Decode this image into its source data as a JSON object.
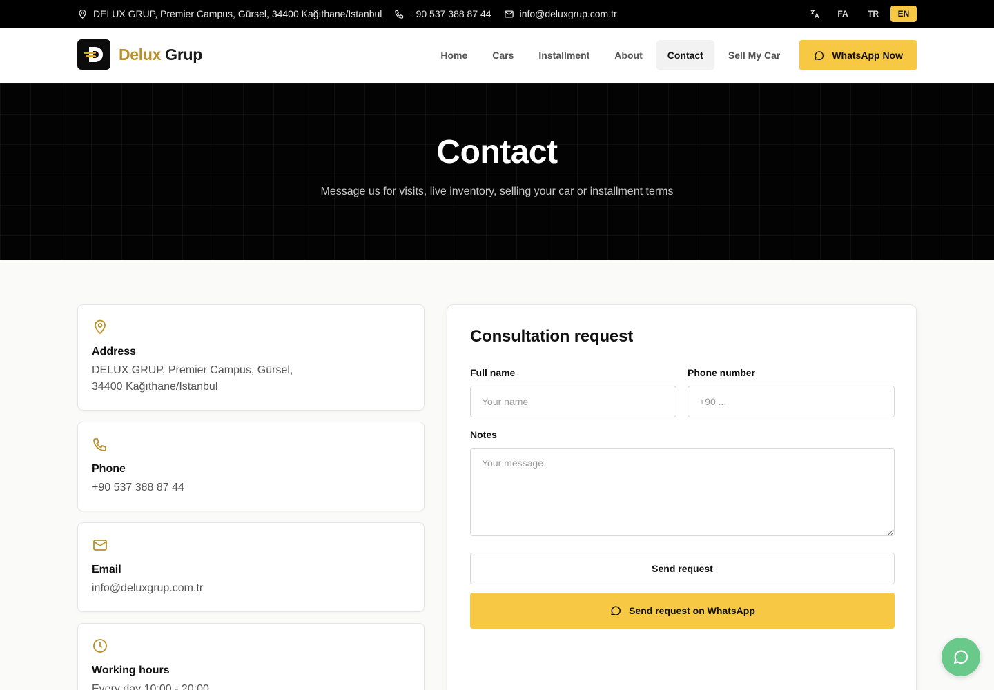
{
  "topbar": {
    "address": "DELUX GRUP, Premier Campus, Gürsel, 34400 Kağıthane/Istanbul",
    "phone": "+90 537 388 87 44",
    "email": "info@deluxgrup.com.tr",
    "languages": [
      "FA",
      "TR",
      "EN"
    ],
    "active_language": "EN"
  },
  "header": {
    "logo_part1": "Delux",
    "logo_part2": "Grup",
    "nav": [
      "Home",
      "Cars",
      "Installment",
      "About",
      "Contact",
      "Sell My Car"
    ],
    "active_nav": "Contact",
    "cta_label": "WhatsApp Now"
  },
  "hero": {
    "title": "Contact",
    "subtitle": "Message us for visits, live inventory, selling your car or installment terms"
  },
  "cards": {
    "address_title": "Address",
    "address_value": "DELUX GRUP, Premier Campus, Gürsel, 34400 Kağıthane/Istanbul",
    "phone_title": "Phone",
    "phone_value": "+90 537 388 87 44",
    "email_title": "Email",
    "email_value": "info@deluxgrup.com.tr",
    "hours_title": "Working hours",
    "hours_value": "Every day 10:00 - 20:00"
  },
  "form": {
    "title": "Consultation request",
    "name_label": "Full name",
    "name_placeholder": "Your name",
    "phone_label": "Phone number",
    "phone_placeholder": "+90 ...",
    "notes_label": "Notes",
    "notes_placeholder": "Your message",
    "send_label": "Send request",
    "send_whatsapp_label": "Send request on WhatsApp"
  },
  "colors": {
    "accent": "#f7c844",
    "logo_gold": "#b8912b",
    "whatsapp_float": "#68c98a",
    "topbar": "#000000"
  },
  "icons": {
    "address": "map-pin-icon",
    "phone": "phone-icon",
    "email": "mail-icon",
    "hours": "clock-icon",
    "language": "translate-icon",
    "whatsapp": "chat-bubble-icon"
  }
}
